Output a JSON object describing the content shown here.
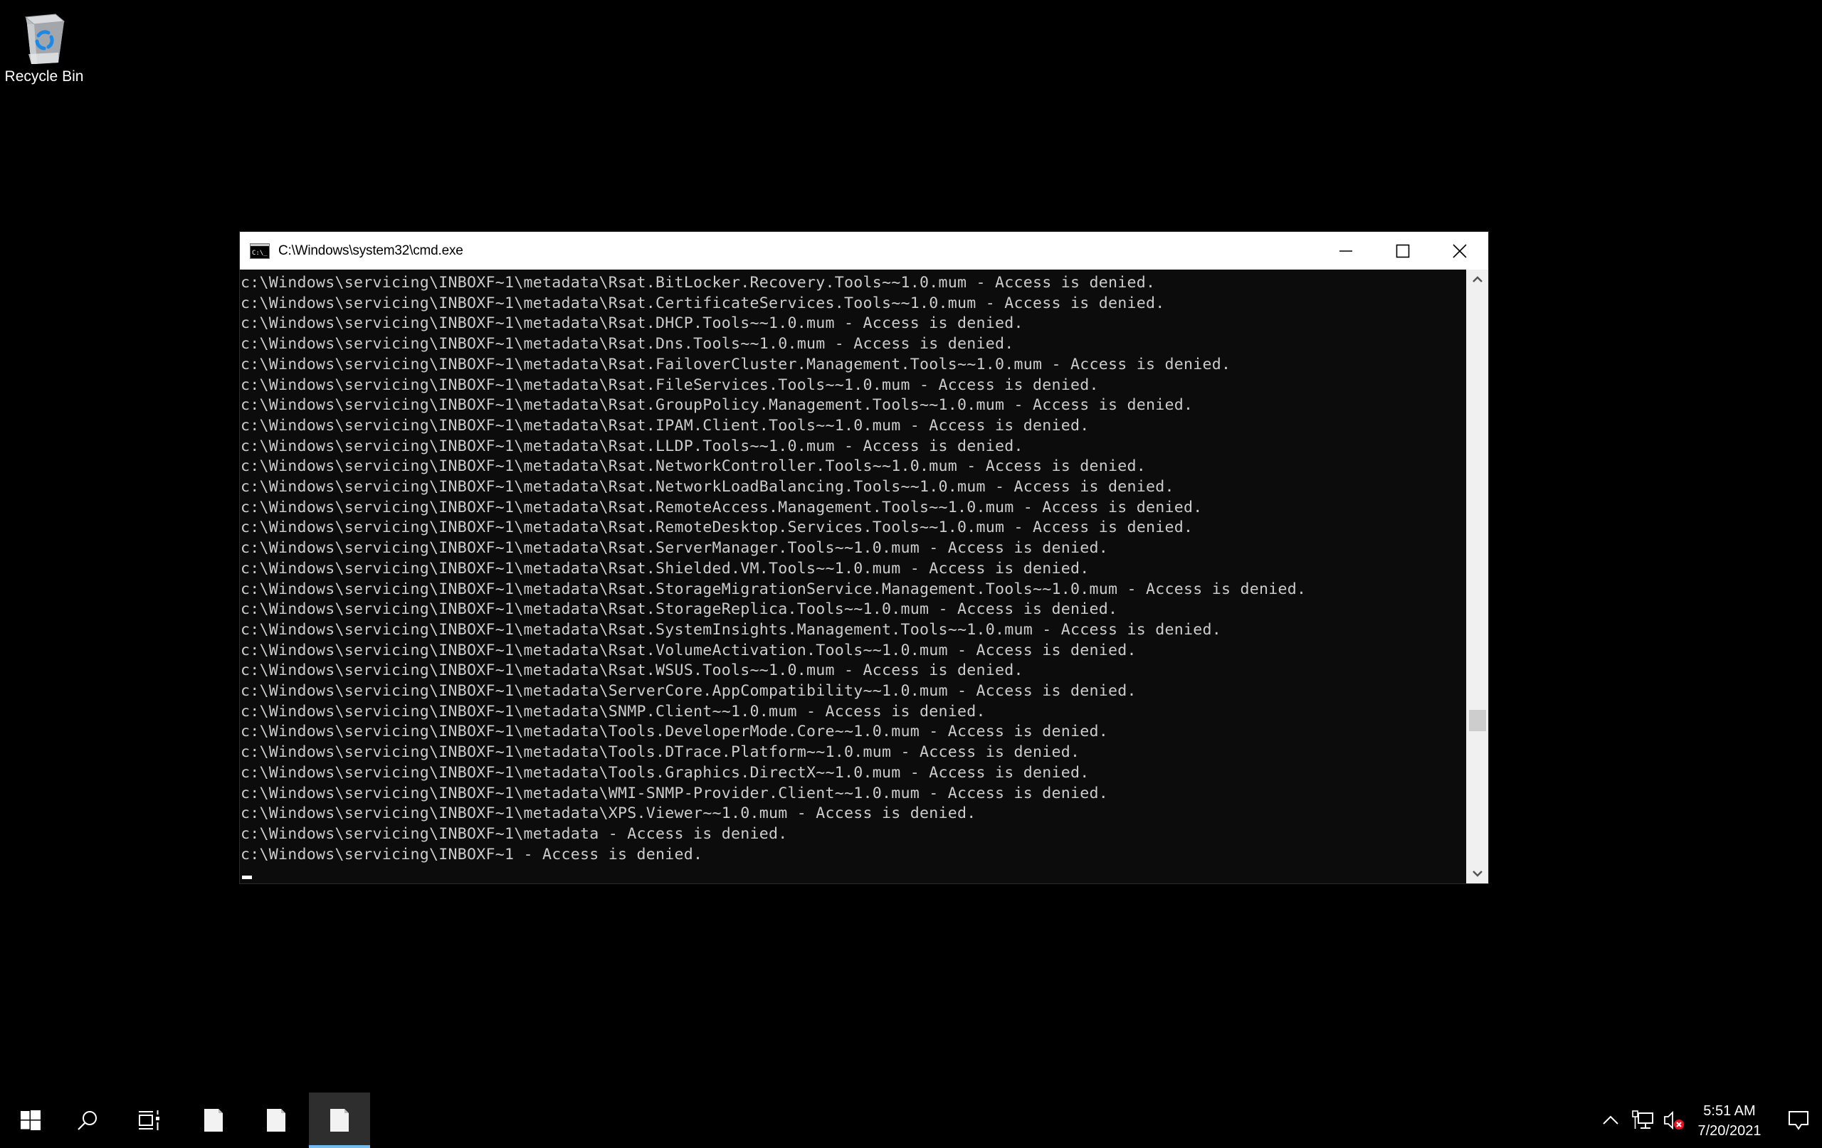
{
  "desktop": {
    "icons": [
      {
        "label": "Recycle Bin",
        "icon": "recycle-bin-icon"
      }
    ]
  },
  "window": {
    "title": "C:\\Windows\\system32\\cmd.exe",
    "app_icon": "cmd-icon",
    "controls": {
      "minimize": "minimize-icon",
      "maximize": "maximize-icon",
      "close": "close-icon"
    },
    "console_lines": [
      "c:\\Windows\\servicing\\INBOXF~1\\metadata\\Rsat.BitLocker.Recovery.Tools~~1.0.mum - Access is denied.",
      "c:\\Windows\\servicing\\INBOXF~1\\metadata\\Rsat.CertificateServices.Tools~~1.0.mum - Access is denied.",
      "c:\\Windows\\servicing\\INBOXF~1\\metadata\\Rsat.DHCP.Tools~~1.0.mum - Access is denied.",
      "c:\\Windows\\servicing\\INBOXF~1\\metadata\\Rsat.Dns.Tools~~1.0.mum - Access is denied.",
      "c:\\Windows\\servicing\\INBOXF~1\\metadata\\Rsat.FailoverCluster.Management.Tools~~1.0.mum - Access is denied.",
      "c:\\Windows\\servicing\\INBOXF~1\\metadata\\Rsat.FileServices.Tools~~1.0.mum - Access is denied.",
      "c:\\Windows\\servicing\\INBOXF~1\\metadata\\Rsat.GroupPolicy.Management.Tools~~1.0.mum - Access is denied.",
      "c:\\Windows\\servicing\\INBOXF~1\\metadata\\Rsat.IPAM.Client.Tools~~1.0.mum - Access is denied.",
      "c:\\Windows\\servicing\\INBOXF~1\\metadata\\Rsat.LLDP.Tools~~1.0.mum - Access is denied.",
      "c:\\Windows\\servicing\\INBOXF~1\\metadata\\Rsat.NetworkController.Tools~~1.0.mum - Access is denied.",
      "c:\\Windows\\servicing\\INBOXF~1\\metadata\\Rsat.NetworkLoadBalancing.Tools~~1.0.mum - Access is denied.",
      "c:\\Windows\\servicing\\INBOXF~1\\metadata\\Rsat.RemoteAccess.Management.Tools~~1.0.mum - Access is denied.",
      "c:\\Windows\\servicing\\INBOXF~1\\metadata\\Rsat.RemoteDesktop.Services.Tools~~1.0.mum - Access is denied.",
      "c:\\Windows\\servicing\\INBOXF~1\\metadata\\Rsat.ServerManager.Tools~~1.0.mum - Access is denied.",
      "c:\\Windows\\servicing\\INBOXF~1\\metadata\\Rsat.Shielded.VM.Tools~~1.0.mum - Access is denied.",
      "c:\\Windows\\servicing\\INBOXF~1\\metadata\\Rsat.StorageMigrationService.Management.Tools~~1.0.mum - Access is denied.",
      "c:\\Windows\\servicing\\INBOXF~1\\metadata\\Rsat.StorageReplica.Tools~~1.0.mum - Access is denied.",
      "c:\\Windows\\servicing\\INBOXF~1\\metadata\\Rsat.SystemInsights.Management.Tools~~1.0.mum - Access is denied.",
      "c:\\Windows\\servicing\\INBOXF~1\\metadata\\Rsat.VolumeActivation.Tools~~1.0.mum - Access is denied.",
      "c:\\Windows\\servicing\\INBOXF~1\\metadata\\Rsat.WSUS.Tools~~1.0.mum - Access is denied.",
      "c:\\Windows\\servicing\\INBOXF~1\\metadata\\ServerCore.AppCompatibility~~1.0.mum - Access is denied.",
      "c:\\Windows\\servicing\\INBOXF~1\\metadata\\SNMP.Client~~1.0.mum - Access is denied.",
      "c:\\Windows\\servicing\\INBOXF~1\\metadata\\Tools.DeveloperMode.Core~~1.0.mum - Access is denied.",
      "c:\\Windows\\servicing\\INBOXF~1\\metadata\\Tools.DTrace.Platform~~1.0.mum - Access is denied.",
      "c:\\Windows\\servicing\\INBOXF~1\\metadata\\Tools.Graphics.DirectX~~1.0.mum - Access is denied.",
      "c:\\Windows\\servicing\\INBOXF~1\\metadata\\WMI-SNMP-Provider.Client~~1.0.mum - Access is denied.",
      "c:\\Windows\\servicing\\INBOXF~1\\metadata\\XPS.Viewer~~1.0.mum - Access is denied.",
      "c:\\Windows\\servicing\\INBOXF~1\\metadata - Access is denied.",
      "c:\\Windows\\servicing\\INBOXF~1 - Access is denied."
    ],
    "scrollbar": {
      "position_fraction": 0.76
    }
  },
  "taskbar": {
    "buttons": [
      {
        "name": "start",
        "icon": "windows-start-icon"
      },
      {
        "name": "search",
        "icon": "search-icon"
      },
      {
        "name": "task-view",
        "icon": "task-view-icon"
      },
      {
        "name": "app-1",
        "icon": "document-icon",
        "active": false
      },
      {
        "name": "app-2",
        "icon": "document-icon",
        "active": false
      },
      {
        "name": "app-3",
        "icon": "document-icon",
        "active": true
      }
    ],
    "tray": {
      "icons": [
        "chevron-up-icon",
        "network-icon",
        "volume-muted-icon"
      ],
      "time": "5:51 AM",
      "date": "7/20/2021",
      "notifications_icon": "action-center-icon"
    },
    "colors": {
      "active_indicator": "#76b9ed",
      "active_bg": "#2e2e2e"
    }
  }
}
